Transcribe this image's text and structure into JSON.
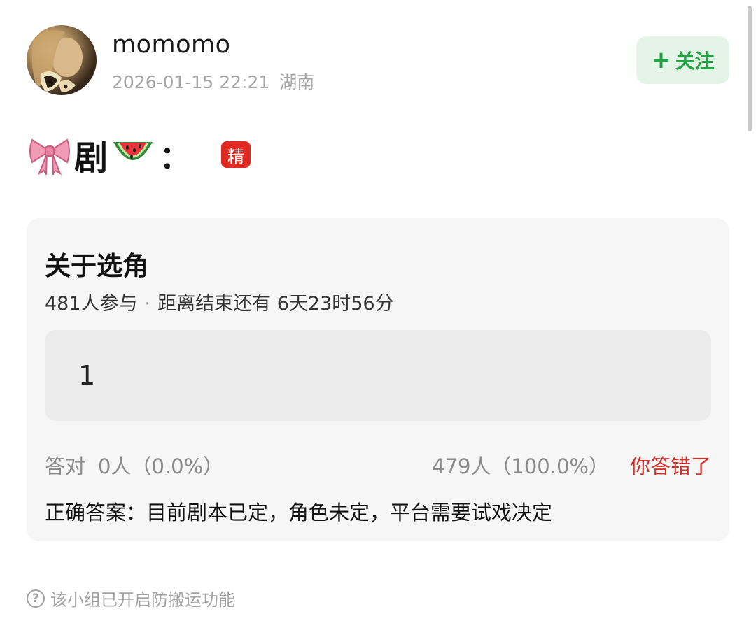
{
  "post": {
    "username": "momomo",
    "datetime": "2026-01-15 22:21",
    "location": "湖南",
    "follow_label": "关注",
    "title": "剧",
    "title_colon": "：",
    "badge": "精"
  },
  "quiz": {
    "title": "关于选角",
    "participants": "481人参与",
    "separator": "·",
    "countdown": "距离结束还有 6天23时56分",
    "option_text": "1",
    "correct_label": "答对",
    "correct_stats": "0人（0.0%）",
    "other_stats": "479人（100.0%）",
    "result": "你答错了",
    "answer": "正确答案：目前剧本已定，角色未定，平台需要试戏决定"
  },
  "footer": {
    "note": "该小组已开启防搬运功能"
  },
  "colors": {
    "follow_bg": "#e4f5e8",
    "follow_text": "#22a344",
    "badge_bg": "#e02a21",
    "wrong_text": "#d2302a"
  },
  "icons": {
    "follow": "plus-icon",
    "title_prefix": "ribbon-bow-icon",
    "title_suffix": "watermelon-icon",
    "footer": "question-circle-icon"
  }
}
